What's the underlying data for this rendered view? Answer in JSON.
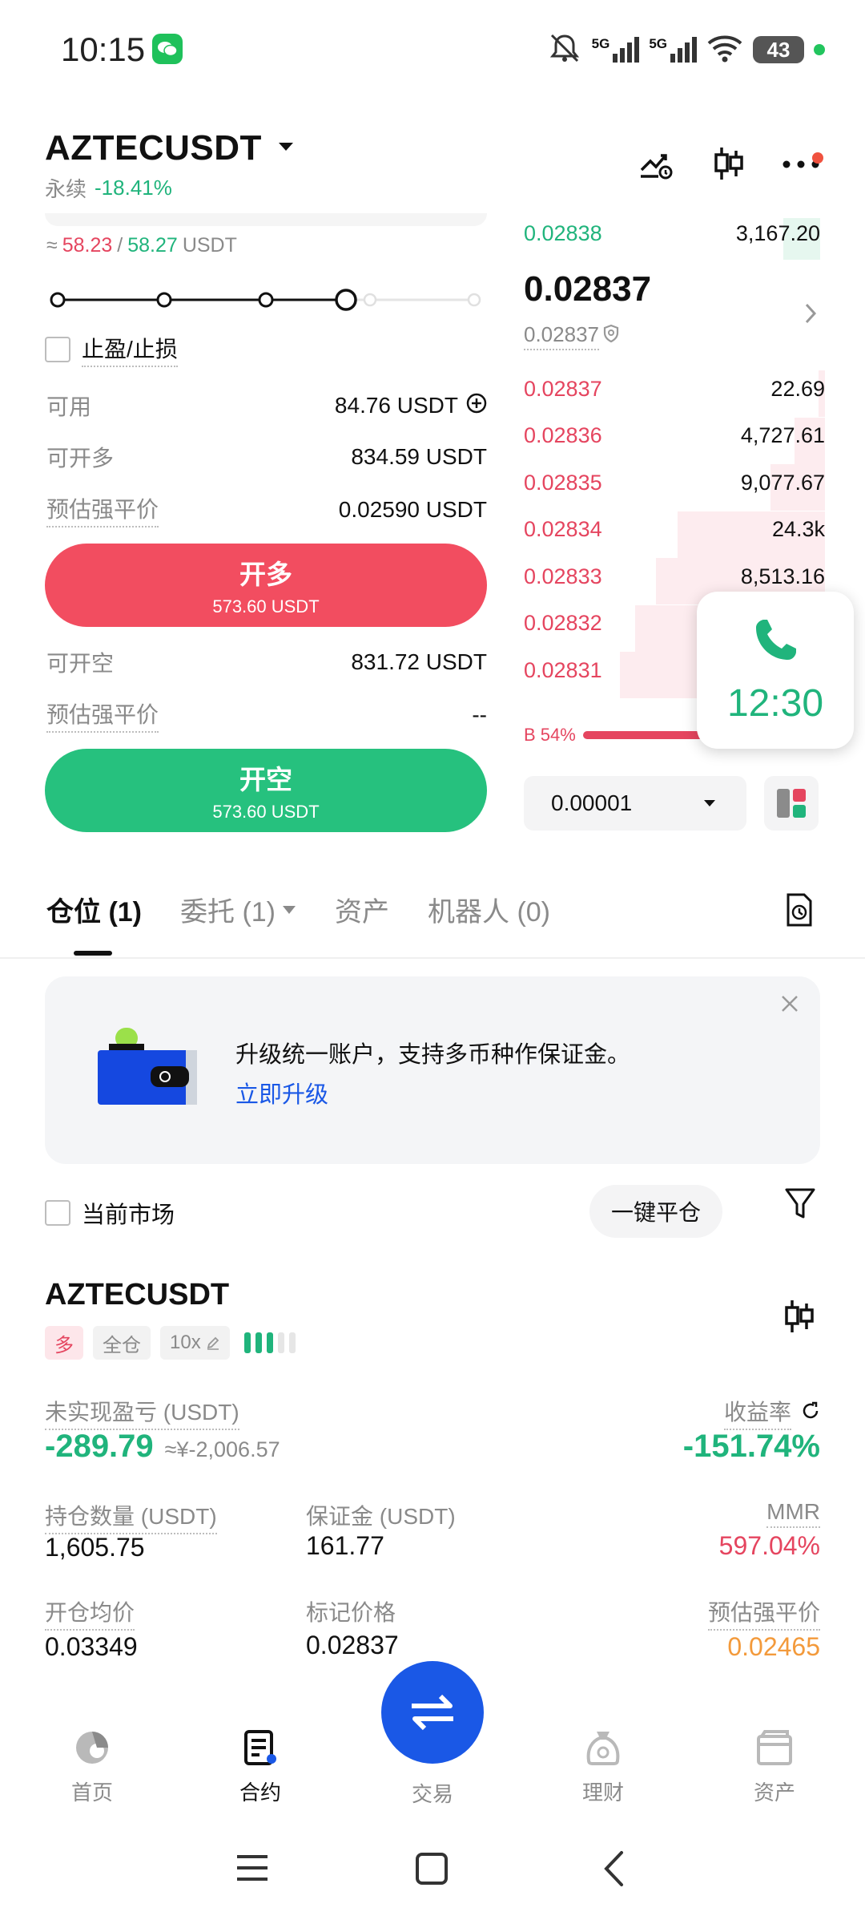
{
  "status": {
    "time": "10:15",
    "net1": "5G",
    "net2": "5G",
    "battery": "43"
  },
  "header": {
    "symbol": "AZTECUSDT",
    "perp_label": "永续",
    "change": "-18.41%"
  },
  "left": {
    "approx_prefix": "≈",
    "bid_est": "58.23",
    "sep": "/",
    "ask_est": "58.27",
    "unit": "USDT",
    "tpsl_label": "止盈/止损",
    "available_label": "可用",
    "available_value": "84.76  USDT",
    "can_long_label": "可开多",
    "can_long_value": "834.59 USDT",
    "liq_label_1": "预估强平价",
    "liq_value_1": "0.02590 USDT",
    "long_btn": "开多",
    "long_amount": "573.60 USDT",
    "can_short_label": "可开空",
    "can_short_value": "831.72 USDT",
    "liq_label_2": "预估强平价",
    "liq_value_2": "--",
    "short_btn": "开空",
    "short_amount": "573.60 USDT"
  },
  "orderbook": {
    "top_ask": {
      "price": "0.02838",
      "qty": "3,167.20"
    },
    "last_price": "0.02837",
    "mark_price": "0.02837",
    "bids": [
      {
        "price": "0.02837",
        "qty": "22.69",
        "depth": 0.02
      },
      {
        "price": "0.02836",
        "qty": "4,727.61",
        "depth": 0.1
      },
      {
        "price": "0.02835",
        "qty": "9,077.67",
        "depth": 0.18
      },
      {
        "price": "0.02834",
        "qty": "24.3k",
        "depth": 0.49
      },
      {
        "price": "0.02833",
        "qty": "8,513.16",
        "depth": 0.56
      },
      {
        "price": "0.02832",
        "qty": "",
        "depth": 0.63
      },
      {
        "price": "0.02831",
        "qty": "",
        "depth": 0.68
      }
    ],
    "ratio_label": "B 54%",
    "ratio_buy": 0.54,
    "tick_size": "0.00001"
  },
  "call": {
    "duration": "12:30"
  },
  "tabs": [
    {
      "label": "仓位 (1)"
    },
    {
      "label": "委托 (1)"
    },
    {
      "label": "资产"
    },
    {
      "label": "机器人 (0)"
    }
  ],
  "promo": {
    "text": "升级统一账户，支持多币种作保证金。",
    "link": "立即升级"
  },
  "filters": {
    "current_market": "当前市场",
    "close_all": "一键平仓"
  },
  "position": {
    "symbol": "AZTECUSDT",
    "side_tag": "多",
    "margin_tag": "全仓",
    "leverage_tag": "10x",
    "unrealized_label": "未实现盈亏 (USDT)",
    "unrealized_value": "-289.79",
    "unrealized_cny": "≈¥-2,006.57",
    "roe_label": "收益率",
    "roe_value": "-151.74%",
    "size_label": "持仓数量 (USDT)",
    "size_value": "1,605.75",
    "margin_label": "保证金 (USDT)",
    "margin_value": "161.77",
    "mmr_label": "MMR",
    "mmr_value": "597.04%",
    "entry_label": "开仓均价",
    "entry_value": "0.03349",
    "mark_label": "标记价格",
    "mark_value": "0.02837",
    "liq_label": "预估强平价",
    "liq_value": "0.02465"
  },
  "nav": [
    {
      "label": "首页"
    },
    {
      "label": "合约"
    },
    {
      "label": "交易"
    },
    {
      "label": "理财"
    },
    {
      "label": "资产"
    }
  ],
  "colors": {
    "green": "#20b47c",
    "red": "#e5455f",
    "blue": "#1a58e6",
    "orange": "#f39a3b"
  }
}
